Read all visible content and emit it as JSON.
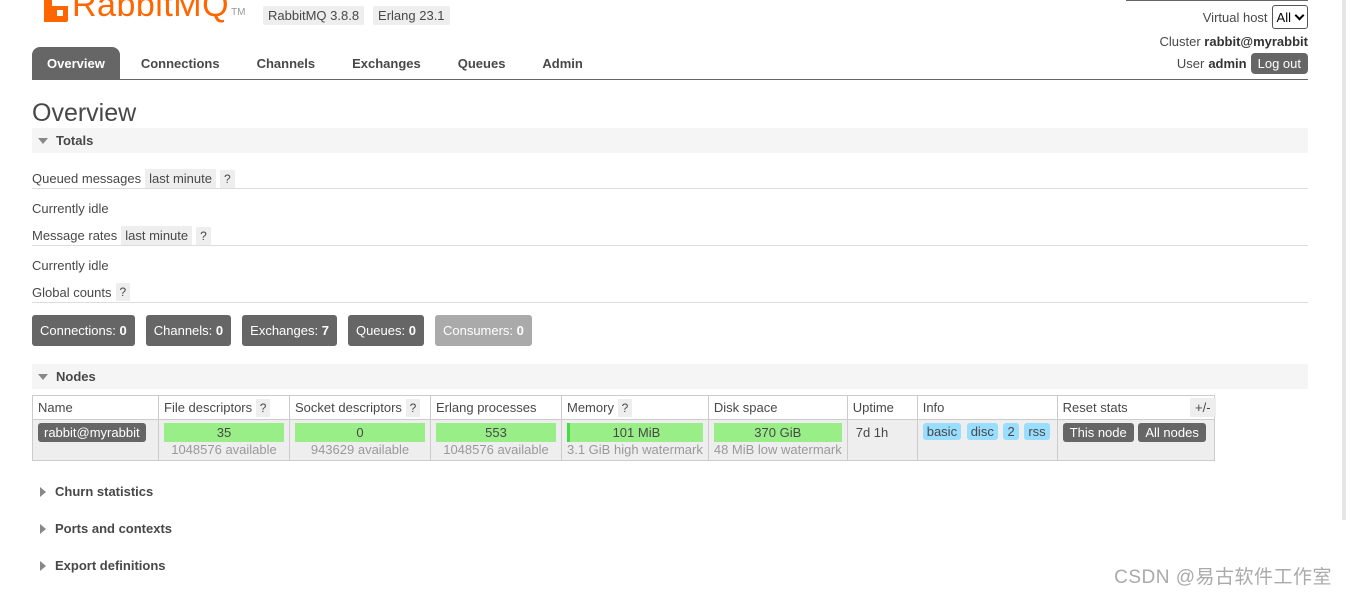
{
  "header": {
    "logo_text": "RabbitMQ",
    "logo_tm": "TM",
    "version_rabbit": "RabbitMQ 3.8.8",
    "version_erlang": "Erlang 23.1",
    "virtual_host_label": "Virtual host",
    "virtual_host_value": "All",
    "cluster_label": "Cluster",
    "cluster_value": "rabbit@myrabbit",
    "user_label": "User",
    "user_value": "admin",
    "logout_label": "Log out"
  },
  "tabs": [
    "Overview",
    "Connections",
    "Channels",
    "Exchanges",
    "Queues",
    "Admin"
  ],
  "page_title": "Overview",
  "totals": {
    "section_title": "Totals",
    "queued_label": "Queued messages",
    "queued_range": "last minute",
    "help": "?",
    "idle1": "Currently idle",
    "rates_label": "Message rates",
    "rates_range": "last minute",
    "idle2": "Currently idle",
    "global_label": "Global counts"
  },
  "counts": {
    "connections_label": "Connections:",
    "connections": "0",
    "channels_label": "Channels:",
    "channels": "0",
    "exchanges_label": "Exchanges:",
    "exchanges": "7",
    "queues_label": "Queues:",
    "queues": "0",
    "consumers_label": "Consumers:",
    "consumers": "0"
  },
  "nodes": {
    "section_title": "Nodes",
    "columns": [
      "Name",
      "File descriptors",
      "Socket descriptors",
      "Erlang processes",
      "Memory",
      "Disk space",
      "Uptime",
      "Info",
      "Reset stats"
    ],
    "plusminus": "+/-",
    "row": {
      "name": "rabbit@myrabbit",
      "fd": "35",
      "fd_sub": "1048576 available",
      "sd": "0",
      "sd_sub": "943629 available",
      "ep": "553",
      "ep_sub": "1048576 available",
      "mem": "101 MiB",
      "mem_sub": "3.1 GiB high watermark",
      "disk": "370 GiB",
      "disk_sub": "48 MiB low watermark",
      "uptime": "7d 1h",
      "info": [
        "basic",
        "disc",
        "2",
        "rss"
      ],
      "reset_this": "This node",
      "reset_all": "All nodes"
    }
  },
  "collapsed_sections": [
    "Churn statistics",
    "Ports and contexts",
    "Export definitions"
  ],
  "watermark": "CSDN @易古软件工作室",
  "colors": {
    "accent": "#ff6600",
    "dark": "#666666",
    "green": "#99ee88",
    "blue": "#99ddff"
  }
}
